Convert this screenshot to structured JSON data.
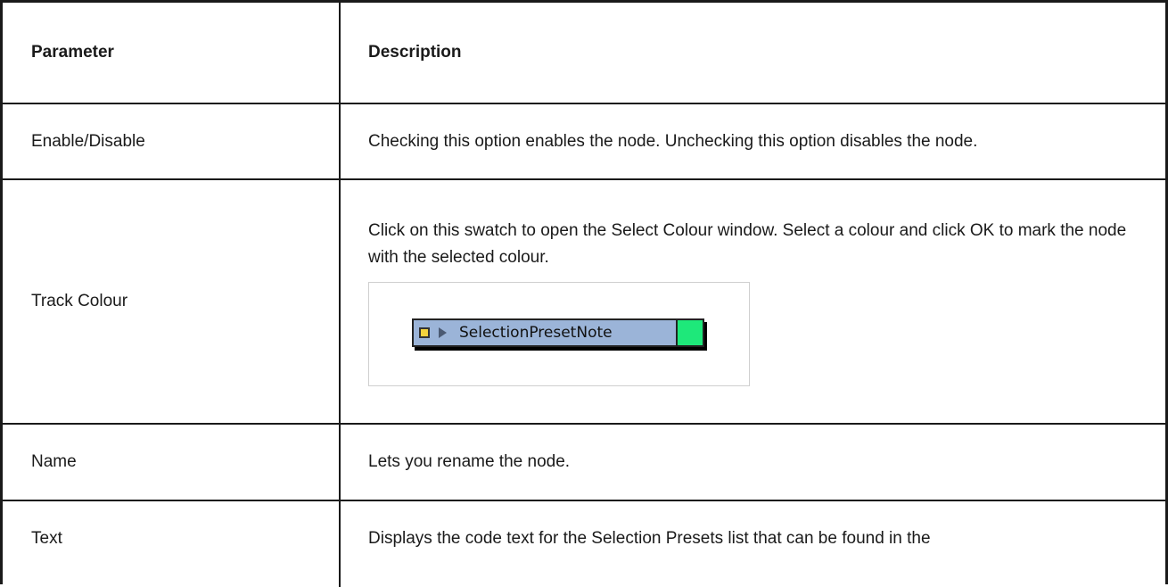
{
  "table": {
    "headers": {
      "parameter": "Parameter",
      "description": "Description"
    },
    "rows": [
      {
        "parameter": "Enable/Disable",
        "description": "Checking this option enables the node. Unchecking this option disables the node."
      },
      {
        "parameter": "Track Colour",
        "description": "Click on this swatch to open the Select Colour window. Select a colour and click OK to mark the node with the selected colour.",
        "node_example": {
          "label": "SelectionPresetNote",
          "swatch_color": "#1ee87a",
          "port_color": "#f4d33d",
          "node_color": "#9bb4d8"
        }
      },
      {
        "parameter": "Name",
        "description": "Lets you rename the node."
      },
      {
        "parameter": "Text",
        "description": "Displays the code text for the Selection Presets list that can be found in the"
      }
    ]
  }
}
